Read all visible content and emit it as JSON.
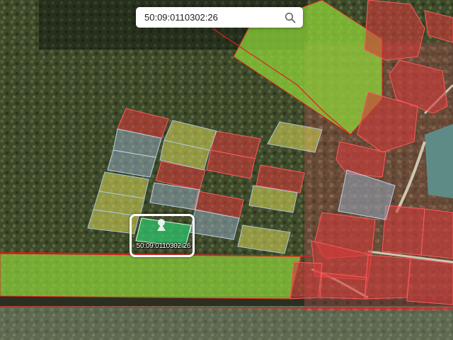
{
  "search": {
    "value": "50:09:0110302:26",
    "icon": "search-icon"
  },
  "selected_parcel": {
    "cadastral_number": "50:09:0110302:26",
    "marker_icon": "location-pin-icon"
  },
  "colors": {
    "residential_parcel": "#d23a3a",
    "agricultural_field": "#8fd43a",
    "unregistered_plot": "#d9d95a",
    "pending_plot": "#9ab0c8",
    "selected_parcel": "#2ecc71",
    "boundary_line": "#e02020"
  }
}
